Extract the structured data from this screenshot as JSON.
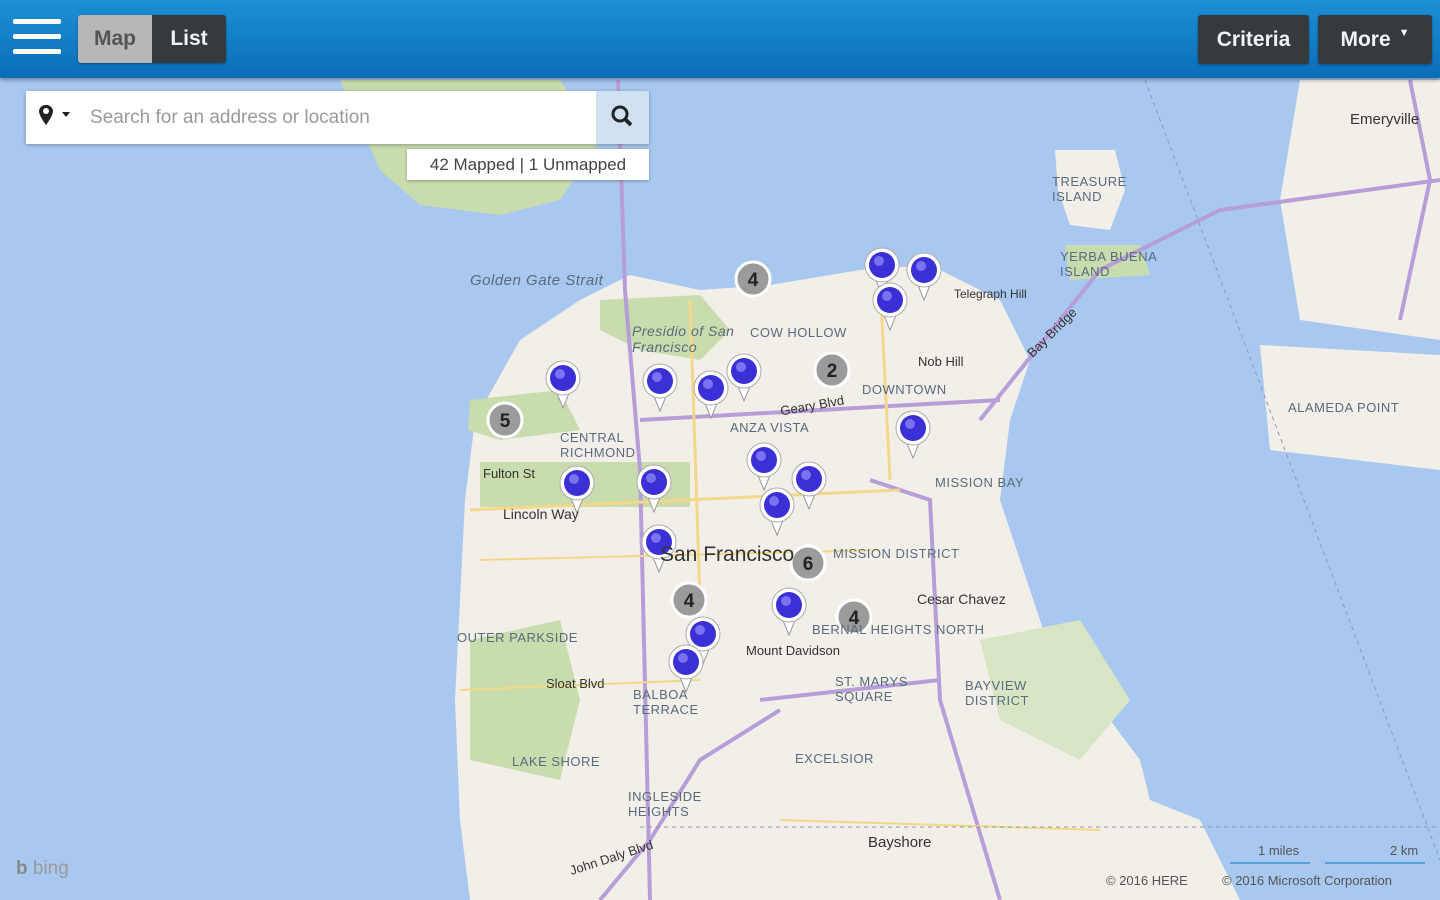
{
  "header": {
    "menu_icon": "hamburger-icon",
    "tabs": [
      {
        "label": "Map",
        "active": true
      },
      {
        "label": "List",
        "active": false
      }
    ],
    "criteria_label": "Criteria",
    "more_label": "More",
    "more_icon": "caret-down-icon"
  },
  "search": {
    "location_icon": "map-pin-icon",
    "dropdown_icon": "caret-down-icon",
    "placeholder": "Search for an address or location",
    "value": "",
    "button_icon": "search-icon",
    "counts": "42 Mapped | 1 Unmapped"
  },
  "map": {
    "water_color": "#a9c8f0",
    "land_color": "#f2efe9",
    "park_color": "#c8dcae",
    "pin_color": "#3b2fd6",
    "cluster_color": "#8a8a8a",
    "labels": [
      "Golden Gate Strait",
      "Presidio of San Francisco",
      "COW HOLLOW",
      "CENTRAL RICHMOND",
      "ANZA VISTA",
      "DOWNTOWN",
      "MISSION BAY",
      "MISSION DISTRICT",
      "OUTER PARKSIDE",
      "BERNAL HEIGHTS NORTH",
      "BAYVIEW DISTRICT",
      "LAKE SHORE",
      "INGLESIDE HEIGHTS",
      "EXCELSIOR",
      "BALBOA TERRACE",
      "ST. MARYS SQUARE",
      "TREASURE ISLAND",
      "YERBA BUENA ISLAND",
      "ALAMEDA POINT",
      "Emeryville",
      "San Francisco",
      "Bayshore",
      "Geary Blvd",
      "Fulton St",
      "Lincoln Way",
      "Sloat Blvd",
      "Cesar Chavez",
      "Mount Davidson",
      "Nob Hill",
      "Telegraph Hill",
      "Bay Bridge",
      "John Daly Blvd"
    ],
    "clusters": [
      {
        "count": "4"
      },
      {
        "count": "2"
      },
      {
        "count": "5"
      },
      {
        "count": "6"
      },
      {
        "count": "4"
      },
      {
        "count": "4"
      }
    ],
    "pin_count": 16,
    "brand": "bing",
    "scale_miles": "1 miles",
    "scale_km": "2 km",
    "copyright_here": "© 2016 HERE",
    "copyright_ms": "© 2016 Microsoft Corporation"
  }
}
